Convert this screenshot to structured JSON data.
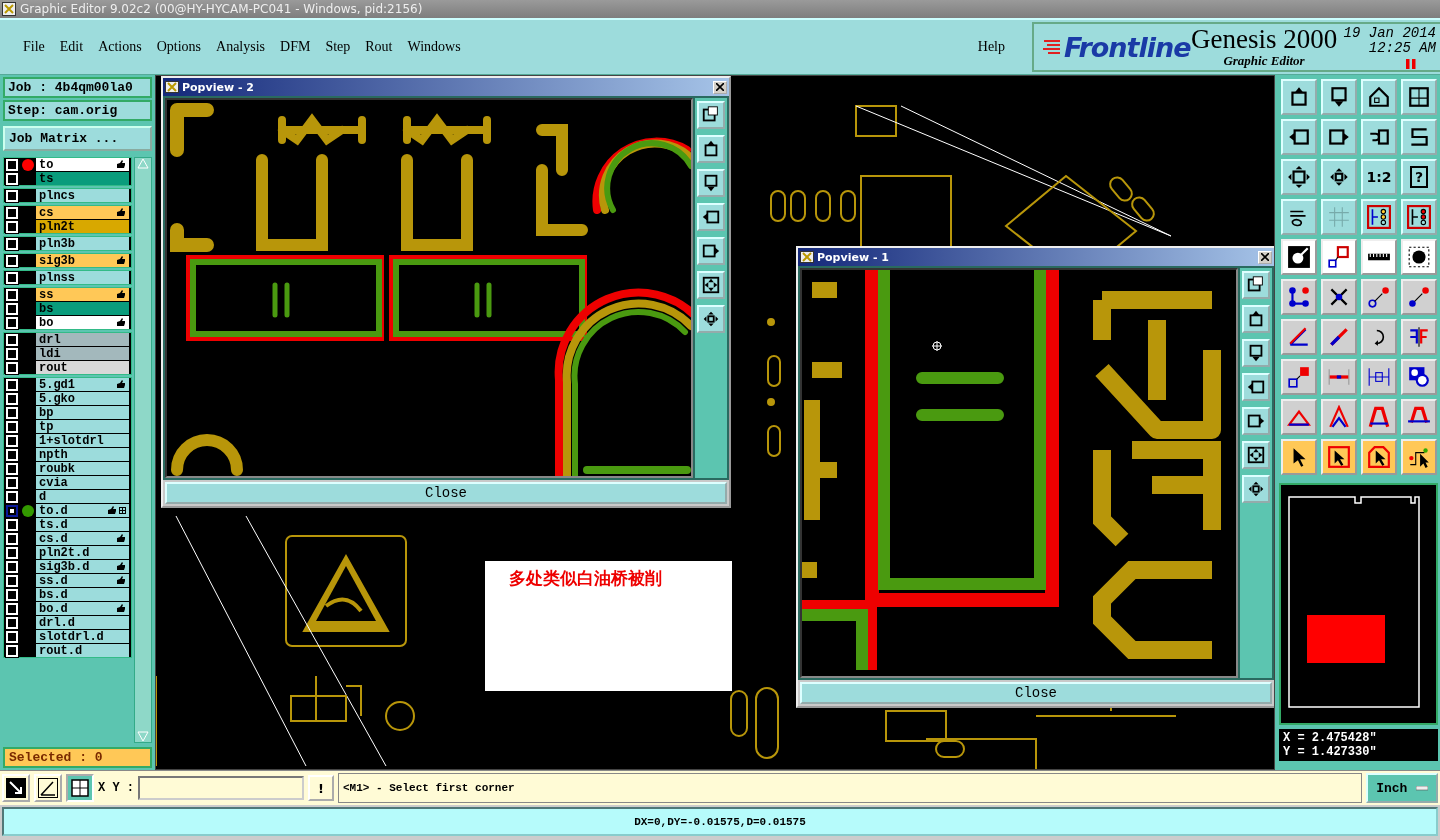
{
  "window": {
    "title": "Graphic Editor 9.02c2 (00@HY-HYCAM-PC041 - Windows, pid:2156)"
  },
  "menu": [
    "File",
    "Edit",
    "Actions",
    "Options",
    "Analysis",
    "DFM",
    "Step",
    "Rout",
    "Windows"
  ],
  "help": "Help",
  "brand": {
    "logo": "Frontline",
    "product": "Genesis 2000",
    "subtitle": "Graphic Editor",
    "date": "19 Jan 2014",
    "time": "12:25 AM"
  },
  "job": {
    "job": "Job : 4b4qm00la0",
    "step": "Step: cam.orig",
    "matrix_button": "Job Matrix ..."
  },
  "layer_groups": [
    [
      {
        "name": "to",
        "color": "#ffffff",
        "dot": {
          "color": "#ff0000"
        },
        "hand": true,
        "work": false
      },
      {
        "name": "ts",
        "color": "#0a9c7c",
        "hand": false,
        "work": false
      }
    ],
    [
      {
        "name": "plncs",
        "color": "#9cdcdc",
        "hand": false,
        "work": false
      }
    ],
    [
      {
        "name": "cs",
        "color": "#ffc857",
        "hand": true,
        "work": false
      },
      {
        "name": "pln2t",
        "color": "#d8a800",
        "hand": false,
        "work": false
      }
    ],
    [
      {
        "name": "pln3b",
        "color": "#9cdcdc",
        "hand": false,
        "work": false
      }
    ],
    [
      {
        "name": "sig3b",
        "color": "#ffc857",
        "hand": true,
        "work": false
      }
    ],
    [
      {
        "name": "plnss",
        "color": "#9cdcdc",
        "hand": false,
        "work": false
      }
    ],
    [
      {
        "name": "ss",
        "color": "#ffc857",
        "hand": true,
        "work": false
      },
      {
        "name": "bs",
        "color": "#0a9c7c",
        "hand": false,
        "work": false
      },
      {
        "name": "bo",
        "color": "#ffffff",
        "hand": true,
        "work": false
      }
    ],
    [
      {
        "name": "drl",
        "color": "#a3b8bc",
        "hand": false,
        "work": false
      },
      {
        "name": "ldi",
        "color": "#a3b8bc",
        "hand": false,
        "work": false
      },
      {
        "name": "rout",
        "color": "#d8d8d8",
        "hand": false,
        "work": false
      }
    ],
    [
      {
        "name": "5.gd1",
        "color": "#9cdcdc",
        "hand": true,
        "work": false
      },
      {
        "name": "5.gko",
        "color": "#9cdcdc",
        "hand": false,
        "work": false
      },
      {
        "name": "bp",
        "color": "#9cdcdc",
        "hand": false,
        "work": false
      },
      {
        "name": "tp",
        "color": "#9cdcdc",
        "hand": false,
        "work": false
      },
      {
        "name": "1+slotdrl",
        "color": "#9cdcdc",
        "hand": false,
        "work": false
      },
      {
        "name": "npth",
        "color": "#9cdcdc",
        "hand": false,
        "work": false
      },
      {
        "name": "roubk",
        "color": "#9cdcdc",
        "hand": false,
        "work": false
      },
      {
        "name": "cvia",
        "color": "#9cdcdc",
        "hand": false,
        "work": false
      },
      {
        "name": "d",
        "color": "#9cdcdc",
        "hand": false,
        "work": false
      },
      {
        "name": "to.d",
        "color": "#9cdcdc",
        "dot": {
          "color": "#339900"
        },
        "hand": true,
        "work": true
      },
      {
        "name": "ts.d",
        "color": "#9cdcdc",
        "hand": false,
        "work": false
      },
      {
        "name": "cs.d",
        "color": "#9cdcdc",
        "hand": true,
        "work": false
      },
      {
        "name": "pln2t.d",
        "color": "#9cdcdc",
        "hand": false,
        "work": false
      },
      {
        "name": "sig3b.d",
        "color": "#9cdcdc",
        "hand": true,
        "work": false
      },
      {
        "name": "ss.d",
        "color": "#9cdcdc",
        "hand": true,
        "work": false
      },
      {
        "name": "bs.d",
        "color": "#9cdcdc",
        "hand": false,
        "work": false
      },
      {
        "name": "bo.d",
        "color": "#9cdcdc",
        "hand": true,
        "work": false
      },
      {
        "name": "drl.d",
        "color": "#9cdcdc",
        "hand": false,
        "work": false
      },
      {
        "name": "slotdrl.d",
        "color": "#9cdcdc",
        "hand": false,
        "work": false
      },
      {
        "name": "rout.d",
        "color": "#9cdcdc",
        "hand": false,
        "work": false
      }
    ]
  ],
  "selected_count": "Selected : 0",
  "popviews": [
    {
      "title": "Popview - 2",
      "close": "Close",
      "kind": "resistors"
    },
    {
      "title": "Popview - 1",
      "close": "Close",
      "kind": "capacitor"
    }
  ],
  "annotation": "多处类似白油桥被削",
  "tools": {
    "ratio": "1:2",
    "help": "?"
  },
  "coordinates": {
    "x": "X = 2.475428\"",
    "y": "Y = 1.427330\""
  },
  "command": {
    "xy_label": "X Y :",
    "bang": "!",
    "prompt": "<M1> - Select first corner",
    "units": "Inch"
  },
  "status": "DX=0,DY=-0.01575,D=0.01575"
}
